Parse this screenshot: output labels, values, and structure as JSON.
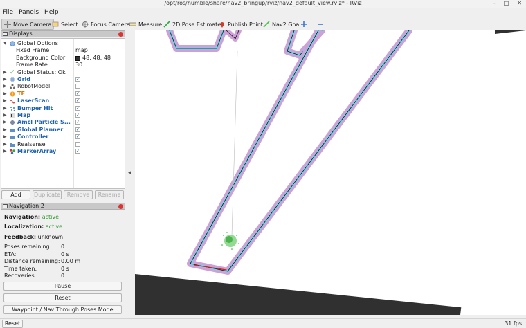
{
  "window": {
    "title": "/opt/ros/humble/share/nav2_bringup/rviz/nav2_default_view.rviz* - RViz",
    "min": "–",
    "max": "□",
    "close": "✕"
  },
  "menu": {
    "file": "File",
    "panels": "Panels",
    "help": "Help"
  },
  "toolbar": {
    "move_camera": "Move Camera",
    "select": "Select",
    "focus_camera": "Focus Camera",
    "measure": "Measure",
    "pose_estimate": "2D Pose Estimate",
    "publish_point": "Publish Point",
    "nav2_goal": "Nav2 Goal"
  },
  "displays": {
    "title": "Displays",
    "global_options": {
      "label": "Global Options",
      "fixed_frame_label": "Fixed Frame",
      "fixed_frame_value": "map",
      "bg_label": "Background Color",
      "bg_value": "48; 48; 48",
      "rate_label": "Frame Rate",
      "rate_value": "30"
    },
    "global_status": "Global Status: Ok",
    "items": [
      {
        "label": "Grid",
        "checked": true
      },
      {
        "label": "RobotModel",
        "checked": false
      },
      {
        "label": "TF",
        "checked": true
      },
      {
        "label": "LaserScan",
        "checked": true
      },
      {
        "label": "Bumper Hit",
        "checked": true
      },
      {
        "label": "Map",
        "checked": true
      },
      {
        "label": "Amcl Particle S...",
        "checked": true
      },
      {
        "label": "Global Planner",
        "checked": true
      },
      {
        "label": "Controller",
        "checked": true
      },
      {
        "label": "Realsense",
        "checked": false
      },
      {
        "label": "MarkerArray",
        "checked": true
      }
    ],
    "buttons": {
      "add": "Add",
      "duplicate": "Duplicate",
      "remove": "Remove",
      "rename": "Rename"
    }
  },
  "nav2": {
    "title": "Navigation 2",
    "navigation_label": "Navigation:",
    "navigation_value": "active",
    "localization_label": "Localization:",
    "localization_value": "active",
    "feedback_label": "Feedback:",
    "feedback_value": "unknown",
    "poses_label": "Poses remaining:",
    "poses_value": "0",
    "eta_label": "ETA:",
    "eta_value": "0 s",
    "distance_label": "Distance remaining:",
    "distance_value": "0.00 m",
    "time_label": "Time taken:",
    "time_value": "0 s",
    "recoveries_label": "Recoveries:",
    "recoveries_value": "0",
    "pause": "Pause",
    "reset": "Reset",
    "waypoint_mode": "Waypoint / Nav Through Poses Mode"
  },
  "status": {
    "reset": "Reset",
    "fps": "31 fps"
  },
  "colors": {
    "status_active": "#2a9a2a",
    "display_name": "#1e62b0",
    "tf_name": "#d07a12",
    "viewport_bg": "#303030",
    "bg_swatch": "#303030"
  }
}
